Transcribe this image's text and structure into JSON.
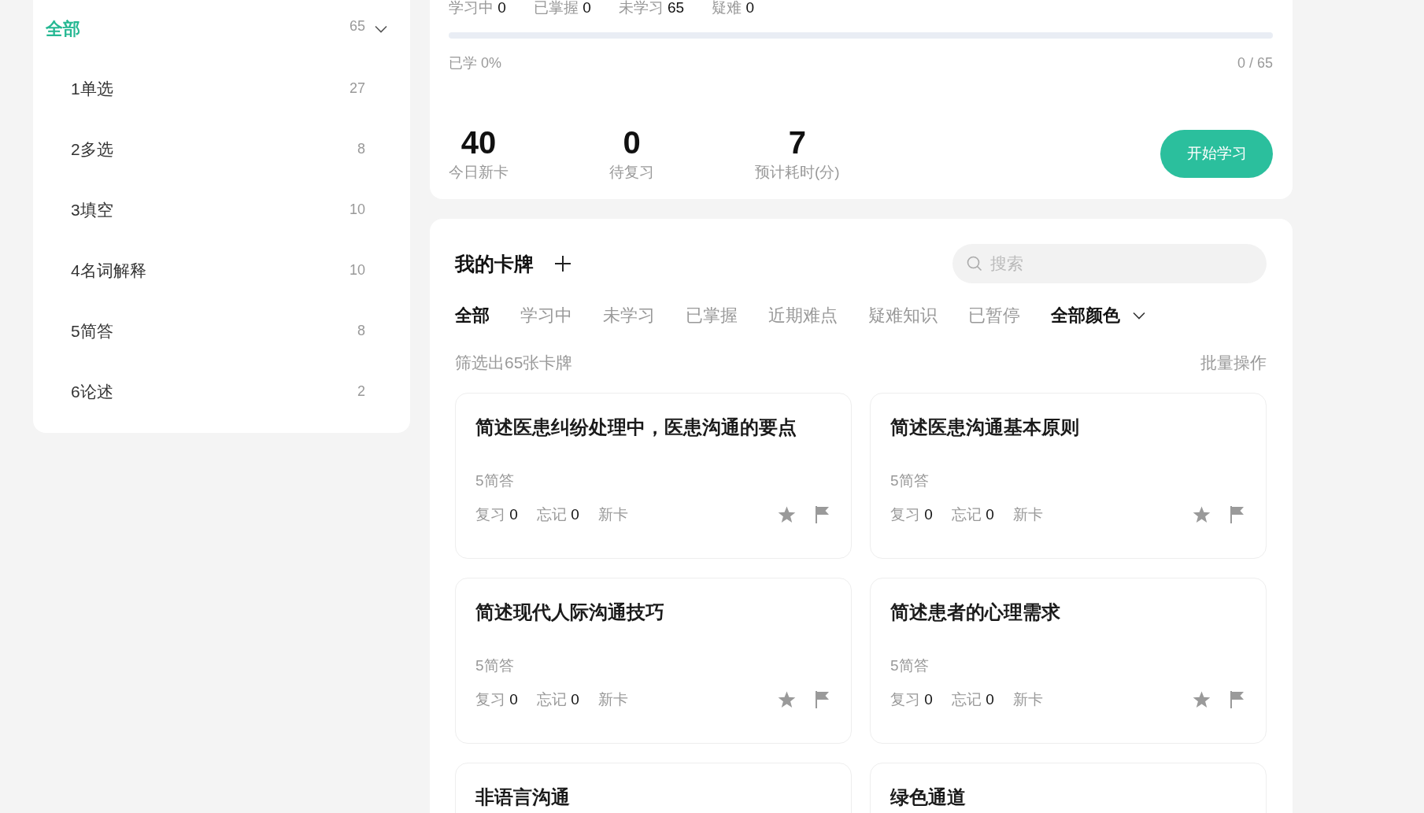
{
  "sidebar": {
    "tree": [
      {
        "label": "全部",
        "count": "65",
        "expanded": true,
        "selected": true,
        "children": [
          {
            "label": "1单选",
            "count": "27",
            "selected": false
          },
          {
            "label": "2多选",
            "count": "8",
            "selected": false
          },
          {
            "label": "3填空",
            "count": "10",
            "selected": false
          },
          {
            "label": "4名词解释",
            "count": "10",
            "selected": false
          },
          {
            "label": "5简答",
            "count": "8",
            "selected": false
          },
          {
            "label": "6论述",
            "count": "2",
            "selected": false
          }
        ]
      }
    ]
  },
  "progress": {
    "stats": [
      {
        "label": "学习中",
        "value": "0"
      },
      {
        "label": "已掌握",
        "value": "0"
      },
      {
        "label": "未学习",
        "value": "65"
      },
      {
        "label": "疑难",
        "value": "0"
      }
    ],
    "level": 0,
    "learned": "已学 0%",
    "ratio": "0 / 65",
    "summary": [
      {
        "value": "40",
        "label": "今日新卡"
      },
      {
        "value": "0",
        "label": "待复习"
      },
      {
        "value": "7",
        "label": "预计耗时(分)"
      }
    ],
    "start_button": "开始学习"
  },
  "cards_panel": {
    "title": "我的卡牌",
    "search": {
      "placeholder": "搜索"
    },
    "filters": [
      {
        "label": "全部",
        "selected": true
      },
      {
        "label": "学习中",
        "selected": false
      },
      {
        "label": "未学习",
        "selected": false
      },
      {
        "label": "已掌握",
        "selected": false
      },
      {
        "label": "近期难点",
        "selected": false
      },
      {
        "label": "疑难知识",
        "selected": false
      },
      {
        "label": "已暂停",
        "selected": false
      }
    ],
    "color_filter": "全部颜色",
    "result_text": "筛选出65张卡牌",
    "batch_action": "批量操作",
    "cards": [
      {
        "title": "简述医患纠纷处理中，医患沟通的要点",
        "category": "5简答",
        "review_label": "复习",
        "review": "0",
        "forget_label": "忘记",
        "forget": "0",
        "status": "新卡",
        "starred": false,
        "flagged": false
      },
      {
        "title": "简述医患沟通基本原则",
        "category": "5简答",
        "review_label": "复习",
        "review": "0",
        "forget_label": "忘记",
        "forget": "0",
        "status": "新卡",
        "starred": false,
        "flagged": false
      },
      {
        "title": "简述现代人际沟通技巧",
        "category": "5简答",
        "review_label": "复习",
        "review": "0",
        "forget_label": "忘记",
        "forget": "0",
        "status": "新卡",
        "starred": false,
        "flagged": false
      },
      {
        "title": "简述患者的心理需求",
        "category": "5简答",
        "review_label": "复习",
        "review": "0",
        "forget_label": "忘记",
        "forget": "0",
        "status": "新卡",
        "starred": false,
        "flagged": false
      },
      {
        "title": "非语言沟通"
      },
      {
        "title": "绿色通道"
      }
    ]
  }
}
